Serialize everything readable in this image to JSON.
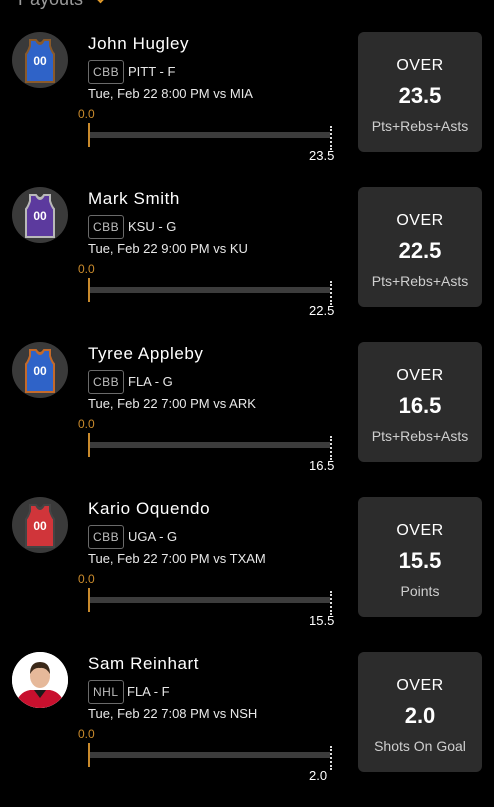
{
  "header": {
    "label": "Payouts",
    "icon": "chevron-down-icon"
  },
  "accent_color": "#e29a2a",
  "picks": [
    {
      "player": "John Hugley",
      "league": "CBB",
      "team_pos": "PITT - F",
      "game": "Tue, Feb 22 8:00 PM vs MIA",
      "current": "0.0",
      "line": "23.5",
      "progress": 0.0,
      "direction": "OVER",
      "stat": "Pts+Rebs+Asts",
      "avatar": {
        "type": "jersey",
        "color": "#2f63c8",
        "trim": "#8a5a2a",
        "number": "00"
      }
    },
    {
      "player": "Mark Smith",
      "league": "CBB",
      "team_pos": "KSU - G",
      "game": "Tue, Feb 22 9:00 PM vs KU",
      "current": "0.0",
      "line": "22.5",
      "progress": 0.0,
      "direction": "OVER",
      "stat": "Pts+Rebs+Asts",
      "avatar": {
        "type": "jersey",
        "color": "#5c3a9e",
        "trim": "#b9b9b9",
        "number": "00"
      }
    },
    {
      "player": "Tyree Appleby",
      "league": "CBB",
      "team_pos": "FLA - G",
      "game": "Tue, Feb 22 7:00 PM vs ARK",
      "current": "0.0",
      "line": "16.5",
      "progress": 0.0,
      "direction": "OVER",
      "stat": "Pts+Rebs+Asts",
      "avatar": {
        "type": "jersey",
        "color": "#2f63c8",
        "trim": "#c46a2a",
        "number": "00"
      }
    },
    {
      "player": "Kario Oquendo",
      "league": "CBB",
      "team_pos": "UGA - G",
      "game": "Tue, Feb 22 7:00 PM vs TXAM",
      "current": "0.0",
      "line": "15.5",
      "progress": 0.0,
      "direction": "OVER",
      "stat": "Points",
      "avatar": {
        "type": "jersey",
        "color": "#d0353a",
        "trim": "#444444",
        "number": "00"
      }
    },
    {
      "player": "Sam Reinhart",
      "league": "NHL",
      "team_pos": "FLA - F",
      "game": "Tue, Feb 22 7:08 PM vs NSH",
      "current": "0.0",
      "line": "2.0",
      "progress": 0.0,
      "direction": "OVER",
      "stat": "Shots On Goal",
      "avatar": {
        "type": "photo"
      }
    }
  ]
}
